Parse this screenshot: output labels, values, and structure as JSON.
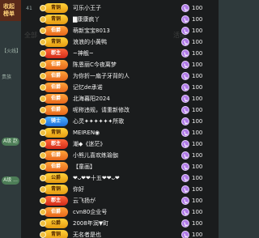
{
  "rank_header": {
    "line1": "收起",
    "line2": "榜单"
  },
  "background": {
    "tabs": [
      {
        "label": "全部"
      },
      {
        "label": "活动"
      }
    ],
    "left_rows": [
      {
        "text": "【火线】"
      },
      {
        "text": "贵族"
      },
      {
        "text": "A级 赵"
      },
      {
        "text": "A级 ..."
      }
    ]
  },
  "list": [
    {
      "num": "41",
      "badge": "青铜",
      "badge_color": "gold",
      "name": "可乐小王子",
      "score": "100"
    },
    {
      "num": "",
      "badge": "青铜",
      "badge_color": "gold",
      "name": "▇康康疯丫",
      "score": "100"
    },
    {
      "num": "",
      "badge": "伯爵",
      "badge_color": "orange",
      "name": "萌新宝宝8013",
      "score": "100"
    },
    {
      "num": "",
      "badge": "青铜",
      "badge_color": "gold",
      "name": "浪浪的小黄鸭",
      "score": "100"
    },
    {
      "num": "",
      "badge": "郡主",
      "badge_color": "red",
      "name": "~神舰~",
      "score": "100"
    },
    {
      "num": "",
      "badge": "伯爵",
      "badge_color": "orange",
      "name": "陈恩丽C今夜离梦",
      "score": "100"
    },
    {
      "num": "",
      "badge": "伯爵",
      "badge_color": "orange",
      "name": "为你折一扇子牙背的人",
      "score": "100"
    },
    {
      "num": "",
      "badge": "伯爵",
      "badge_color": "orange",
      "name": "记忆de承诺",
      "score": "100"
    },
    {
      "num": "",
      "badge": "伯爵",
      "badge_color": "orange",
      "name": "北海暮阳2024",
      "score": "100"
    },
    {
      "num": "",
      "badge": "伯爵",
      "badge_color": "orange",
      "name": "呢称违规，请重新修改",
      "score": "100"
    },
    {
      "num": "",
      "badge": "骑士",
      "badge_color": "blue",
      "name": "心灵✦✦✦✦✦✦所歌",
      "score": "100"
    },
    {
      "num": "",
      "badge": "青铜",
      "badge_color": "gold",
      "name": "MEIREN◉",
      "score": "100"
    },
    {
      "num": "",
      "badge": "郡主",
      "badge_color": "red",
      "name": "潮◆《迷茫》",
      "score": "100"
    },
    {
      "num": "",
      "badge": "伯爵",
      "badge_color": "orange",
      "name": "小熊儿喜欢练瑜伽",
      "score": "100"
    },
    {
      "num": "",
      "badge": "伯爵",
      "badge_color": "orange",
      "name": "【童画】",
      "score": "100"
    },
    {
      "num": "",
      "badge": "公爵",
      "badge_color": "gold",
      "name": "❤ᴗ❤❤十五❤❤ᴗ❤",
      "score": "100"
    },
    {
      "num": "",
      "badge": "青铜",
      "badge_color": "gold",
      "name": "你好",
      "score": "100"
    },
    {
      "num": "",
      "badge": "郡主",
      "badge_color": "red",
      "name": "云飞扬が",
      "score": "100"
    },
    {
      "num": "",
      "badge": "伯爵",
      "badge_color": "orange",
      "name": "cvn80企业号",
      "score": "100"
    },
    {
      "num": "",
      "badge": "公爵",
      "badge_color": "gold",
      "name": "2008年润▼町",
      "score": "100"
    },
    {
      "num": "",
      "badge": "青铜",
      "badge_color": "gold",
      "name": "无名者是也",
      "score": "100"
    }
  ]
}
